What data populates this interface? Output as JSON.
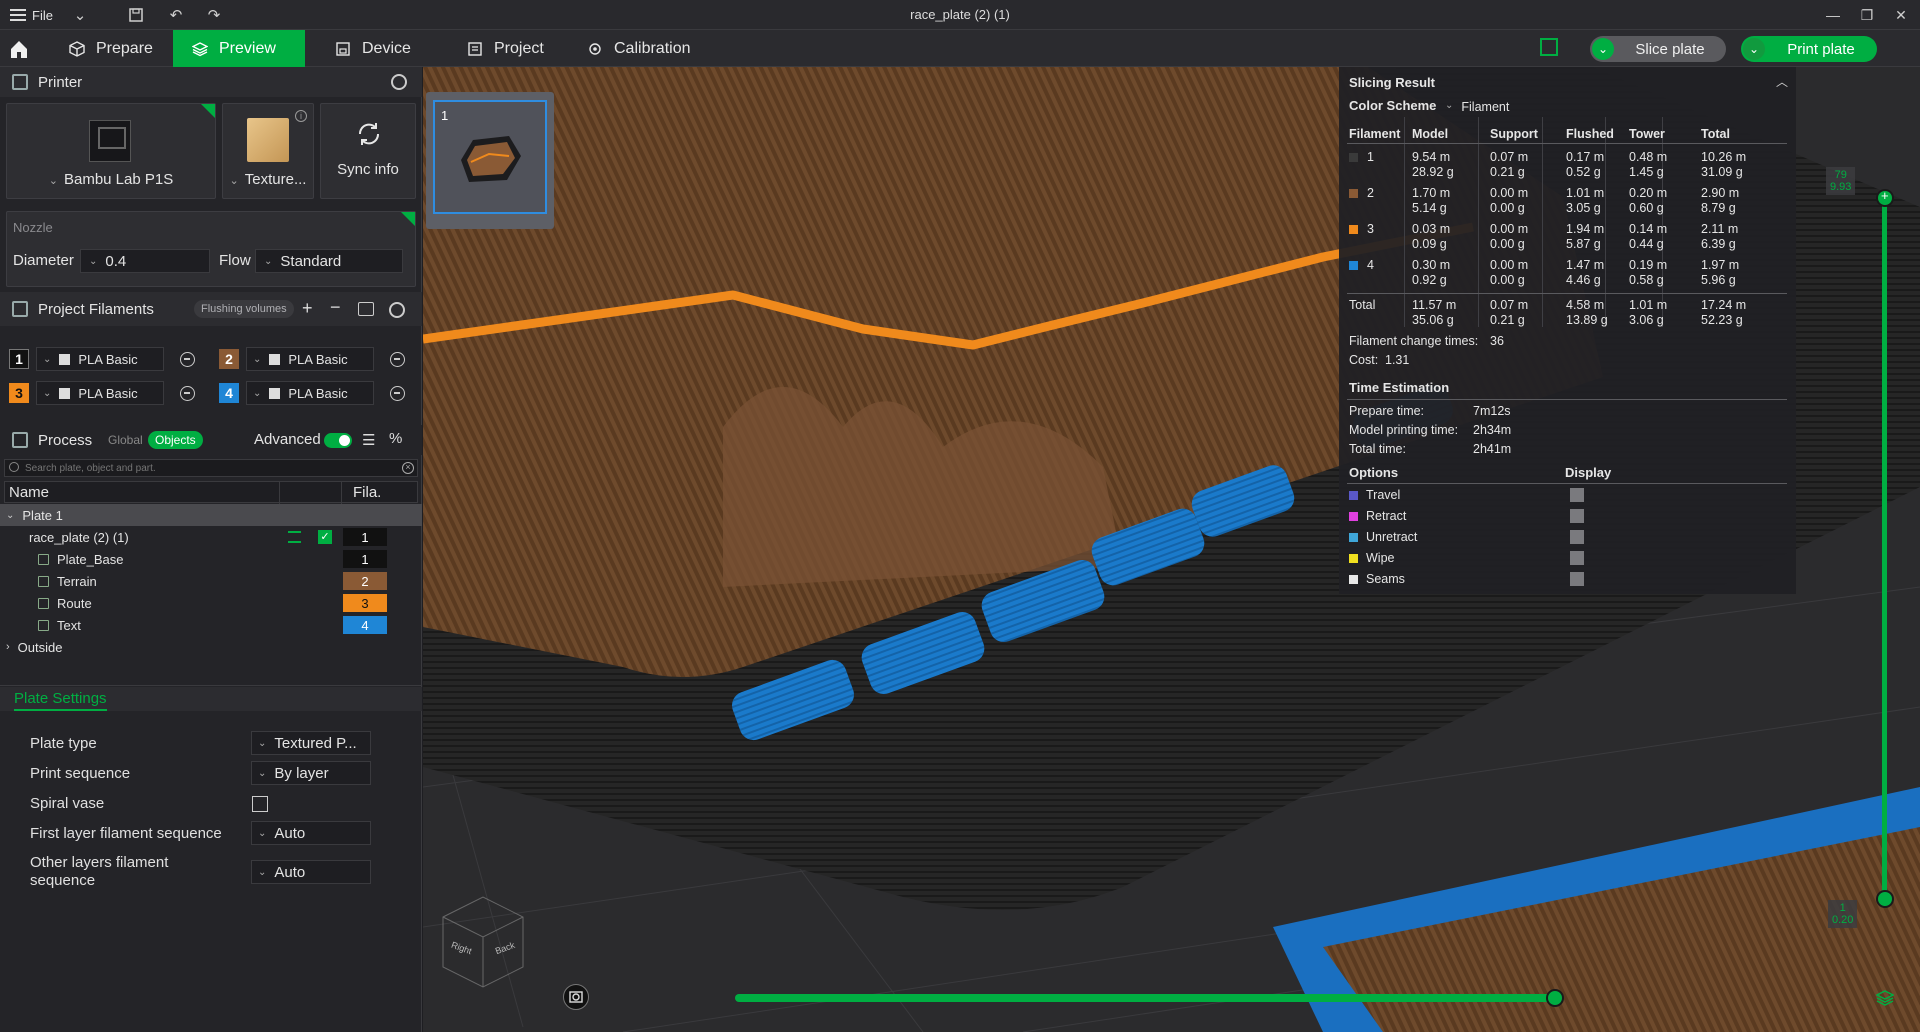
{
  "titlebar": {
    "file_label": "File",
    "window_title": "race_plate (2) (1)"
  },
  "nav": {
    "tabs": [
      {
        "label": "Prepare"
      },
      {
        "label": "Preview"
      },
      {
        "label": "Device"
      },
      {
        "label": "Project"
      },
      {
        "label": "Calibration"
      }
    ],
    "slice_label": "Slice plate",
    "print_label": "Print plate"
  },
  "printer": {
    "section_title": "Printer",
    "printer_name": "Bambu Lab P1S",
    "plate_name": "Texture...",
    "sync_label": "Sync info",
    "nozzle_label": "Nozzle",
    "diameter_label": "Diameter",
    "diameter_value": "0.4",
    "flow_label": "Flow",
    "flow_value": "Standard"
  },
  "filaments": {
    "section_title": "Project Filaments",
    "flushing_label": "Flushing volumes",
    "items": [
      {
        "num": "1",
        "name": "PLA Basic",
        "color": "#111111"
      },
      {
        "num": "2",
        "name": "PLA Basic",
        "color": "#8a5a35"
      },
      {
        "num": "3",
        "name": "PLA Basic",
        "color": "#f08a1c"
      },
      {
        "num": "4",
        "name": "PLA Basic",
        "color": "#1f86d6"
      }
    ]
  },
  "process": {
    "section_title": "Process",
    "global_label": "Global",
    "objects_label": "Objects",
    "advanced_label": "Advanced",
    "search_placeholder": "Search plate, object and part.",
    "col_name": "Name",
    "col_fila": "Fila.",
    "tree": {
      "plate": "Plate 1",
      "object": "race_plate (2) (1)",
      "object_fila": "1",
      "parts": [
        {
          "name": "Plate_Base",
          "fila": "1",
          "color": "#111111"
        },
        {
          "name": "Terrain",
          "fila": "2",
          "color": "#8a5a35"
        },
        {
          "name": "Route",
          "fila": "3",
          "color": "#f08a1c"
        },
        {
          "name": "Text",
          "fila": "4",
          "color": "#1f86d6"
        }
      ],
      "outside": "Outside"
    }
  },
  "plate_settings": {
    "title": "Plate Settings",
    "rows": [
      {
        "label": "Plate type",
        "value": "Textured P..."
      },
      {
        "label": "Print sequence",
        "value": "By layer"
      },
      {
        "label": "Spiral vase",
        "value": ""
      },
      {
        "label": "First layer filament sequence",
        "value": "Auto"
      },
      {
        "label": "Other layers filament sequence",
        "value": "Auto"
      }
    ]
  },
  "thumbnail": {
    "plate_number": "1"
  },
  "slicing_result": {
    "title": "Slicing Result",
    "color_scheme_label": "Color Scheme",
    "color_scheme_value": "Filament",
    "headers": [
      "Filament",
      "Model",
      "Support",
      "Flushed",
      "Tower",
      "Total"
    ],
    "rows": [
      {
        "id": "1",
        "color": "#3a3a3a",
        "model": [
          "9.54 m",
          "28.92 g"
        ],
        "support": [
          "0.07 m",
          "0.21 g"
        ],
        "flushed": [
          "0.17 m",
          "0.52 g"
        ],
        "tower": [
          "0.48 m",
          "1.45 g"
        ],
        "total": [
          "10.26 m",
          "31.09 g"
        ]
      },
      {
        "id": "2",
        "color": "#8a5a35",
        "model": [
          "1.70 m",
          "5.14 g"
        ],
        "support": [
          "0.00 m",
          "0.00 g"
        ],
        "flushed": [
          "1.01 m",
          "3.05 g"
        ],
        "tower": [
          "0.20 m",
          "0.60 g"
        ],
        "total": [
          "2.90 m",
          "8.79 g"
        ]
      },
      {
        "id": "3",
        "color": "#f08a1c",
        "model": [
          "0.03 m",
          "0.09 g"
        ],
        "support": [
          "0.00 m",
          "0.00 g"
        ],
        "flushed": [
          "1.94 m",
          "5.87 g"
        ],
        "tower": [
          "0.14 m",
          "0.44 g"
        ],
        "total": [
          "2.11 m",
          "6.39 g"
        ]
      },
      {
        "id": "4",
        "color": "#1f86d6",
        "model": [
          "0.30 m",
          "0.92 g"
        ],
        "support": [
          "0.00 m",
          "0.00 g"
        ],
        "flushed": [
          "1.47 m",
          "4.46 g"
        ],
        "tower": [
          "0.19 m",
          "0.58 g"
        ],
        "total": [
          "1.97 m",
          "5.96 g"
        ]
      }
    ],
    "totals": {
      "label": "Total",
      "model": [
        "11.57 m",
        "35.06 g"
      ],
      "support": [
        "0.07 m",
        "0.21 g"
      ],
      "flushed": [
        "4.58 m",
        "13.89 g"
      ],
      "tower": [
        "1.01 m",
        "3.06 g"
      ],
      "total": [
        "17.24 m",
        "52.23 g"
      ]
    },
    "change_label": "Filament change times:",
    "change_value": "36",
    "cost_label": "Cost:",
    "cost_value": "1.31",
    "time_title": "Time Estimation",
    "prepare_label": "Prepare time:",
    "prepare_value": "7m12s",
    "model_time_label": "Model printing time:",
    "model_time_value": "2h34m",
    "total_time_label": "Total time:",
    "total_time_value": "2h41m",
    "options_label": "Options",
    "display_label": "Display",
    "options": [
      {
        "name": "Travel",
        "color": "#5a58c8"
      },
      {
        "name": "Retract",
        "color": "#e040e0"
      },
      {
        "name": "Unretract",
        "color": "#3fa6d8"
      },
      {
        "name": "Wipe",
        "color": "#f0e020"
      },
      {
        "name": "Seams",
        "color": "#e8e8e8"
      }
    ]
  },
  "layer_slider": {
    "top_layer": "79",
    "top_height": "9.93",
    "bottom_layer": "1",
    "bottom_height": "0.20"
  },
  "view_cube": {
    "right": "Right",
    "back": "Back"
  }
}
